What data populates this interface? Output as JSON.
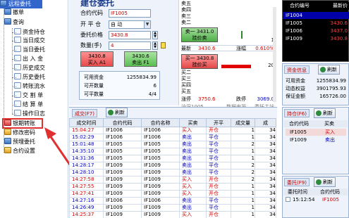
{
  "tree": {
    "top_item": "远程委托",
    "items": [
      {
        "label": "撤单",
        "icon": "cancel-icon"
      },
      {
        "label": "查询",
        "icon": "query-icon"
      },
      {
        "label": "资金持仓",
        "icon": "doc-icon"
      },
      {
        "label": "当日成交",
        "icon": "doc-icon"
      },
      {
        "label": "当日委托",
        "icon": "doc-icon"
      },
      {
        "label": "出 入 金",
        "icon": "doc-icon"
      },
      {
        "label": "历史成交",
        "icon": "doc-icon"
      },
      {
        "label": "历史委托",
        "icon": "doc-icon"
      },
      {
        "label": "转账流水",
        "icon": "doc-icon"
      },
      {
        "label": "交 割 单",
        "icon": "doc-icon"
      },
      {
        "label": "结 算 单",
        "icon": "doc-icon"
      },
      {
        "label": "操作日志",
        "icon": "doc-icon"
      },
      {
        "label": "银期转账",
        "icon": "transfer-icon"
      },
      {
        "label": "修改密码",
        "icon": "key-icon"
      },
      {
        "label": "预埋委托",
        "icon": "preset-icon"
      },
      {
        "label": "合约设置",
        "icon": "settings-icon"
      }
    ]
  },
  "order_form": {
    "title": "建仓委托",
    "contract_label": "合约代码",
    "contract_value": "IF1005",
    "open_close_label": "开 平 仓",
    "open_close_value": "自 动",
    "price_label": "委托价格",
    "price_value": "3430.8",
    "qty_label": "数量(手)",
    "qty_value": "4",
    "buy_btn_price": "3430.8",
    "buy_btn_label": "买入 A1",
    "sell_btn_price": "3430.6",
    "sell_btn_label": "卖出 F1",
    "funds_label": "可用资金",
    "funds_value": "1255834.99",
    "open_label": "可开数量",
    "open_value": "6",
    "close_label": "可平数量",
    "close_value": "4/4"
  },
  "quote": {
    "asks": [
      {
        "label": "卖五",
        "price": "",
        "vol": ""
      },
      {
        "label": "卖四",
        "price": "",
        "vol": ""
      },
      {
        "label": "卖三",
        "price": "",
        "vol": ""
      },
      {
        "label": "卖二",
        "price": "",
        "vol": ""
      }
    ],
    "sell_btn_label": "卖一",
    "sell_btn_price": "3431.0",
    "sell_btn_sub": "挂价卖",
    "sell_vol": "1",
    "last_label": "最新",
    "last_value": "3430.6",
    "chg_label": "涨幅",
    "chg_value": "0.610%",
    "buy_btn_label": "买一",
    "buy_btn_price": "3430.8",
    "buy_btn_sub": "挂价买",
    "buy_vol": "20",
    "bids": [
      {
        "label": "买二"
      },
      {
        "label": "买三"
      },
      {
        "label": "买四"
      },
      {
        "label": "买五"
      }
    ],
    "up_label": "涨停",
    "up_value": "3750.6",
    "down_label": "跌停",
    "down_value": "3069.0",
    "footer_left": "沪深1005",
    "footer_mid": "数据来源",
    "footer_right": "委托主站"
  },
  "contracts": {
    "header_code": "合约编号",
    "header_price": "最新价",
    "rows": [
      {
        "code": "IF1004",
        "price": "",
        "selected": true
      },
      {
        "code": "IF1005",
        "price": "3430.6",
        "selected": false
      },
      {
        "code": "IF1006",
        "price": "3437.0",
        "selected": false
      },
      {
        "code": "IF1009",
        "price": "3430.8",
        "selected": false
      }
    ]
  },
  "funds": {
    "title": "资金信息",
    "refresh": "刷新",
    "rows": [
      {
        "label": "可用资金",
        "value": "1255834.99"
      },
      {
        "label": "动态权益",
        "value": "3901795.93"
      },
      {
        "label": "保证金额",
        "value": "165726.00"
      }
    ]
  },
  "positions": {
    "title": "持仓(F6)",
    "refresh": "刷新",
    "col_code": "合约代码",
    "col_dir": "买卖",
    "rows": [
      {
        "code": "IF1005",
        "dir": "买入"
      },
      {
        "code": "IF1009",
        "dir": "卖出"
      }
    ]
  },
  "orders": {
    "title": "委托(F9)",
    "refresh": "刷新",
    "col_time": "委托时间",
    "col_code": "合约代码",
    "rows": [
      {
        "time": "15:12:54",
        "code": "IF1005"
      }
    ]
  },
  "trades": {
    "title": "成交(F7)",
    "refresh": "刷新",
    "columns": [
      "成交时间",
      "合约代码",
      "合约名称",
      "买卖",
      "开平",
      "成交量",
      "成"
    ],
    "rows": [
      {
        "time": "15:04:27",
        "code": "IF1006",
        "name": "IF1006",
        "dir": "买入",
        "oc": "开仓",
        "vol": "1",
        "px": "34"
      },
      {
        "time": "15:02:29",
        "code": "IF1006",
        "name": "IF1006",
        "dir": "卖出",
        "oc": "平仓",
        "vol": "1",
        "px": "34"
      },
      {
        "time": "15:01:48",
        "code": "IF1005",
        "name": "IF1005",
        "dir": "卖出",
        "oc": "平仓",
        "vol": "2",
        "px": "34"
      },
      {
        "time": "14:35:10",
        "code": "IF1005",
        "name": "IF1005",
        "dir": "卖出",
        "oc": "平仓",
        "vol": "1",
        "px": "34"
      },
      {
        "time": "14:31:36",
        "code": "IF1005",
        "name": "IF1005",
        "dir": "卖出",
        "oc": "平仓",
        "vol": "1",
        "px": "34"
      },
      {
        "time": "14:28:17",
        "code": "IF1009",
        "name": "IF1009",
        "dir": "卖出",
        "oc": "平仓",
        "vol": "2",
        "px": "34"
      },
      {
        "time": "14:28:10",
        "code": "IF1009",
        "name": "IF1009",
        "dir": "卖出",
        "oc": "平仓",
        "vol": "2",
        "px": "34"
      },
      {
        "time": "14:27:58",
        "code": "IF1009",
        "name": "IF1009",
        "dir": "买入",
        "oc": "开仓",
        "vol": "2",
        "px": "34"
      },
      {
        "time": "14:27:55",
        "code": "IF1009",
        "name": "IF1009",
        "dir": "买入",
        "oc": "开仓",
        "vol": "1",
        "px": "34"
      },
      {
        "time": "14:27:41",
        "code": "IF1009",
        "name": "IF1009",
        "dir": "买入",
        "oc": "开仓",
        "vol": "1",
        "px": "34"
      },
      {
        "time": "14:27:16",
        "code": "IF1006",
        "name": "IF1006",
        "dir": "卖出",
        "oc": "平仓",
        "vol": "1",
        "px": "34"
      },
      {
        "time": "14:26:49",
        "code": "IF1009",
        "name": "IF1009",
        "dir": "卖出",
        "oc": "平仓",
        "vol": "1",
        "px": "34"
      },
      {
        "time": "14:25:37",
        "code": "IF1009",
        "name": "IF1009",
        "dir": "买入",
        "oc": "开仓",
        "vol": "1",
        "px": "34"
      }
    ]
  },
  "colors": {
    "buy": "#d00000",
    "sell": "#0000c0",
    "highlight": "#e03030",
    "selection": "#3366cc"
  }
}
